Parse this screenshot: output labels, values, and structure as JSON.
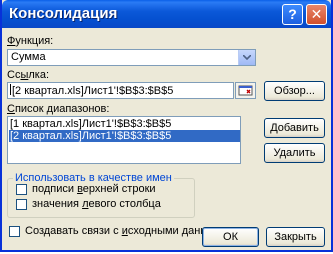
{
  "window": {
    "title": "Консолидация",
    "help_glyph": "?",
    "close_glyph": "✕"
  },
  "function": {
    "label_prefix": "",
    "label_accel": "Ф",
    "label_rest": "ункция:",
    "value": "Сумма"
  },
  "reference": {
    "label_prefix": "Сс",
    "label_accel": "ы",
    "label_rest": "лка:",
    "value": "[2 квартал.xls]Лист1'!$B$3:$B$5"
  },
  "ranges": {
    "label_prefix": "",
    "label_accel": "С",
    "label_rest": "писок диапазонов:",
    "items": [
      {
        "text": "[1 квартал.xls]Лист1'!$B$3:$B$5",
        "selected": false
      },
      {
        "text": "[2 квартал.xls]Лист1'!$B$3:$B$5",
        "selected": true
      }
    ]
  },
  "buttons": {
    "browse": "Обзор...",
    "add": "Добавить",
    "delete": "Удалить",
    "ok": "ОК",
    "close": "Закрыть"
  },
  "names_group": {
    "legend": "Использовать в качестве имен",
    "top_row_prefix": "подписи ",
    "top_row_accel": "в",
    "top_row_rest": "ерхней строки",
    "top_row_checked": false,
    "left_col_prefix": "значения ",
    "left_col_accel": "л",
    "left_col_rest": "евого столбца",
    "left_col_checked": false
  },
  "links": {
    "label_prefix": "Создавать связи с ",
    "label_accel": "и",
    "label_rest": "сходными данными",
    "checked": false
  },
  "colors": {
    "accent": "#0831d9",
    "selection": "#316ac5",
    "group_legend": "#0046d5"
  }
}
